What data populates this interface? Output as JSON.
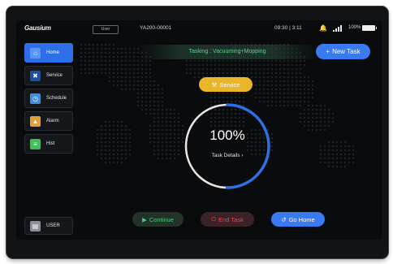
{
  "statusbar": {
    "logo": "Gausium",
    "user_label": "User",
    "device_id": "YA200-00001",
    "time": "09:30 | 3:11",
    "battery": "100%",
    "icons": [
      "bell-icon",
      "signal-icon",
      "battery-icon"
    ]
  },
  "sidebar": {
    "items": [
      {
        "label": "Home",
        "icon": "home-icon",
        "icon_color": "#2d6fe8",
        "active": true
      },
      {
        "label": "Service",
        "icon": "tools-icon",
        "icon_color": "#2d6fe8",
        "active": false
      },
      {
        "label": "Schedule",
        "icon": "schedule-icon",
        "icon_color": "#3b8fe0",
        "active": false
      },
      {
        "label": "Alarm",
        "icon": "alarm-icon",
        "icon_color": "#e0a038",
        "active": false
      },
      {
        "label": "Hist",
        "icon": "history-icon",
        "icon_color": "#3fbf5a",
        "active": false
      }
    ],
    "bottom_item": {
      "label": "USER",
      "icon": "user-card-icon"
    }
  },
  "task": {
    "banner": "Tasking : Vacuuming+Mopping",
    "new_task_label": "New Task"
  },
  "service_label": "Service",
  "progress": {
    "value_text": "100%",
    "details_label": "Task Details",
    "fraction": 1.0
  },
  "actions": {
    "continue_label": "Continue",
    "end_label": "End Task",
    "home_label": "Go Home"
  },
  "colors": {
    "accent_blue": "#3a7af0",
    "service_yellow": "#e9b62a",
    "continue_green": "#4fc47c",
    "end_red": "#e24a4a"
  }
}
